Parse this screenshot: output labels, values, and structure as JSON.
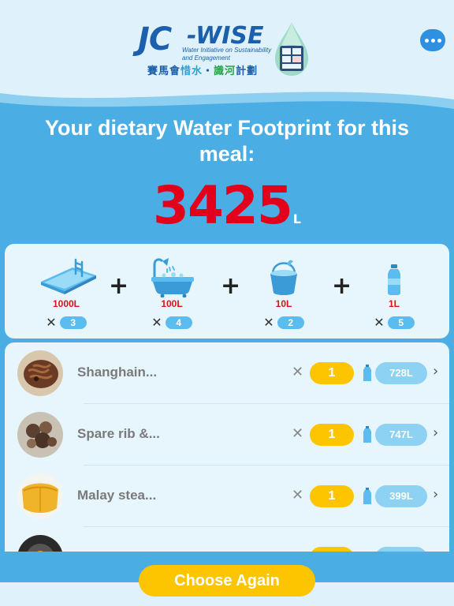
{
  "header": {
    "logo_jc": "JC",
    "logo_wise": "-WISE",
    "logo_subtitle": "Water Initiative on Sustainability and Engagement",
    "logo_cn_1": "賽馬會",
    "logo_cn_2": "惜水",
    "logo_cn_sep": "・",
    "logo_cn_3": "識河",
    "logo_cn_4": "計劃",
    "menu_icon": "more-dots-icon"
  },
  "result": {
    "title": "Your dietary Water Footprint for this meal:",
    "total": "3425",
    "unit": "L"
  },
  "equivalents": [
    {
      "icon": "swimming-pool-icon",
      "amount": "1000L",
      "multiplier": "3"
    },
    {
      "icon": "bathtub-icon",
      "amount": "100L",
      "multiplier": "4"
    },
    {
      "icon": "bucket-icon",
      "amount": "10L",
      "multiplier": "2"
    },
    {
      "icon": "water-bottle-icon",
      "amount": "1L",
      "multiplier": "5"
    }
  ],
  "foods": [
    {
      "name": "Shanghain...",
      "quantity": "1",
      "litres": "728L"
    },
    {
      "name": "Spare rib &...",
      "quantity": "1",
      "litres": "747L"
    },
    {
      "name": "Malay stea...",
      "quantity": "1",
      "litres": "399L"
    }
  ],
  "colors": {
    "brand_blue": "#1c5fad",
    "background": "#4aaee4",
    "total_red": "#e2001a",
    "button_yellow": "#fdc400",
    "litre_pill": "#8dd1f3"
  },
  "footer": {
    "choose_again": "Choose Again"
  }
}
